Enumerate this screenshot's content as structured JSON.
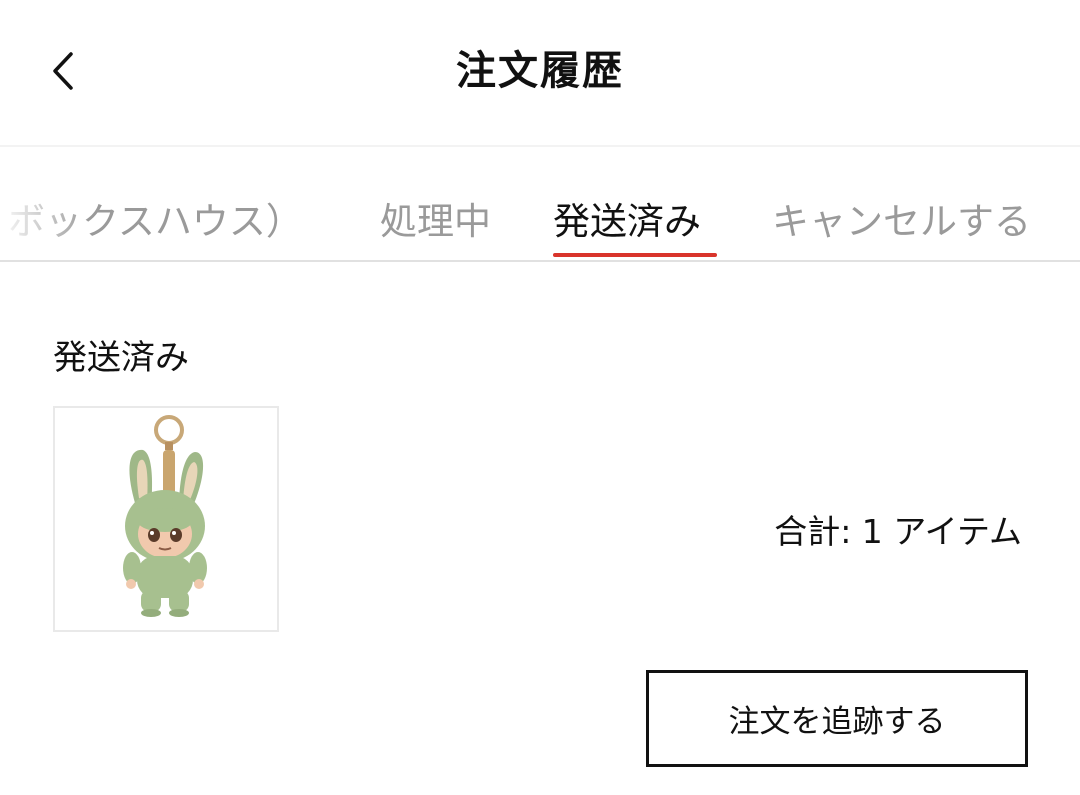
{
  "header": {
    "title": "注文履歴",
    "back_icon": "chevron-left-icon"
  },
  "tabs": [
    {
      "label": "ボックスハウス）",
      "active": false
    },
    {
      "label": "処理中",
      "active": false
    },
    {
      "label": "発送済み",
      "active": true
    },
    {
      "label": "キャンセルする",
      "active": false
    }
  ],
  "colors": {
    "accent": "#d9342b",
    "inactive_tab": "#9a9a9a",
    "text": "#111111"
  },
  "order": {
    "status": "発送済み",
    "product_image": "green-bunny-plush-keychain",
    "total": "合計: 1 アイテム",
    "track_button": "注文を追跡する"
  }
}
